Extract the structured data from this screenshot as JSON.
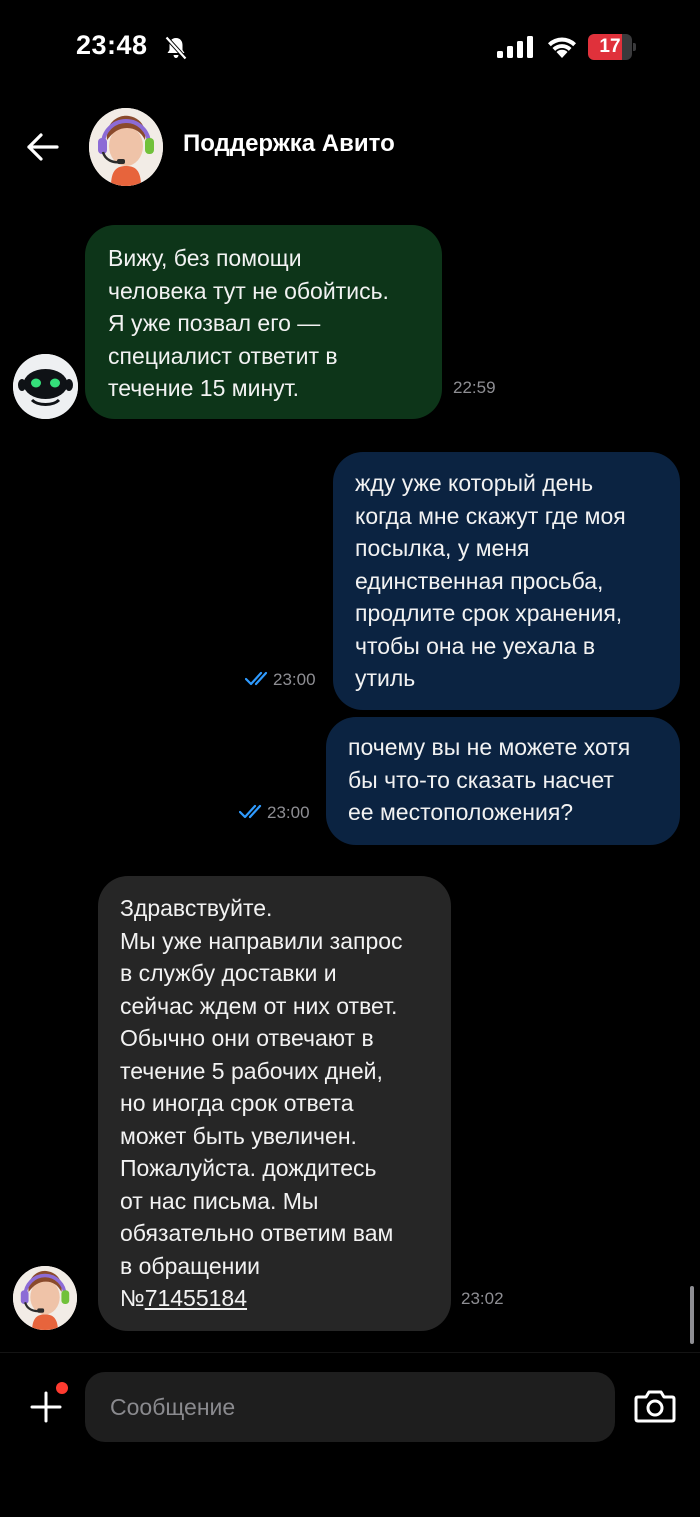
{
  "status_bar": {
    "time": "23:48",
    "battery": "17"
  },
  "header": {
    "title": "Поддержка Авито"
  },
  "messages": [
    {
      "sender": "bot",
      "text": "Вижу, без помощи\nчеловека тут не обойтись.\nЯ уже позвал его —\nспециалист ответит в\nтечение 15 минут.",
      "time": "22:59"
    },
    {
      "sender": "me",
      "text": "жду уже который день\nкогда мне скажут где моя\nпосылка, у меня\nединственная просьба,\nпродлите срок хранения,\nчтобы она не уехала в\nутиль",
      "time": "23:00"
    },
    {
      "sender": "me",
      "text": "почему вы не можете хотя\nбы что-то сказать насчет\nее местоположения?",
      "time": "23:00"
    },
    {
      "sender": "support",
      "text": "Здравствуйте.\nМы уже направили запрос\nв службу доставки и\nсейчас ждем от них ответ.\nОбычно они отвечают в\nтечение 5 рабочих дней,\nно иногда срок ответа\nможет быть увеличен.\nПожалуйста. дождитесь\nот нас письма. Мы\nобязательно ответим вам\nв обращении\n№",
      "ticket_number": "71455184",
      "time": "23:02"
    }
  ],
  "composer": {
    "placeholder": "Сообщение"
  },
  "colors": {
    "background": "#000000",
    "bot_bubble": "#0d3519",
    "outgoing_bubble": "#0b2341",
    "support_bubble": "#262626",
    "read_checks": "#2f9bff",
    "battery_low": "#e0313b"
  },
  "icons": [
    "bell-off-icon",
    "signal-icon",
    "wifi-icon",
    "battery-icon",
    "back-arrow-icon",
    "double-check-icon",
    "plus-icon",
    "camera-icon"
  ]
}
